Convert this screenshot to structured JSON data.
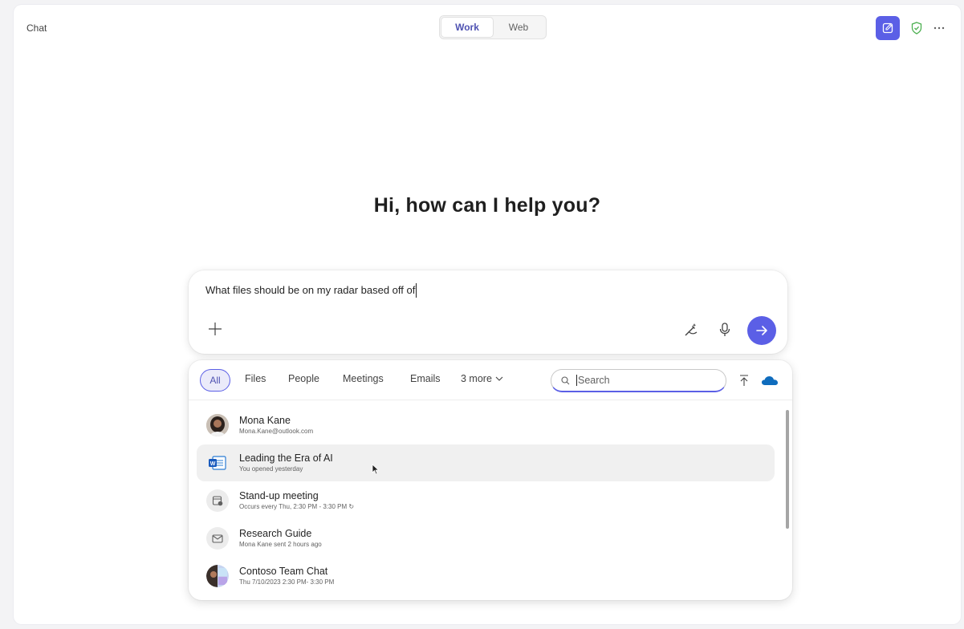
{
  "app": {
    "title": "Chat"
  },
  "mode_toggle": {
    "work": "Work",
    "web": "Web",
    "selected": "Work"
  },
  "greeting": "Hi, how can I help you?",
  "composer": {
    "text": "What files should be on my radar based off of",
    "attach_icon": "plus-icon",
    "prompt_icon": "prompt-wand-icon",
    "mic_icon": "microphone-icon",
    "send_icon": "arrow-right-icon"
  },
  "picker": {
    "filters": [
      "All",
      "Files",
      "People",
      "Meetings",
      "Emails",
      "3 more"
    ],
    "selected_filter": "All",
    "search": {
      "placeholder": "Search",
      "value": ""
    },
    "results": [
      {
        "title": "Mona Kane",
        "subtitle": "Mona.Kane@outlook.com",
        "kind": "person"
      },
      {
        "title": "Leading the Era of AI",
        "subtitle": "You opened yesterday",
        "kind": "word-file"
      },
      {
        "title": "Stand-up meeting",
        "subtitle": "Occurs every Thu, 2:30 PM - 3:30 PM ↻",
        "kind": "meeting"
      },
      {
        "title": "Research Guide",
        "subtitle": "Mona Kane sent 2 hours ago",
        "kind": "email"
      },
      {
        "title": "Contoso Team Chat",
        "subtitle": "Thu 7/10/2023 2:30 PM- 3:30 PM",
        "kind": "group-chat"
      }
    ]
  },
  "colors": {
    "accent": "#5b5fe6",
    "accent_text": "#4f52b2",
    "shield": "#4caf50",
    "cloud": "#0f6cbd"
  }
}
